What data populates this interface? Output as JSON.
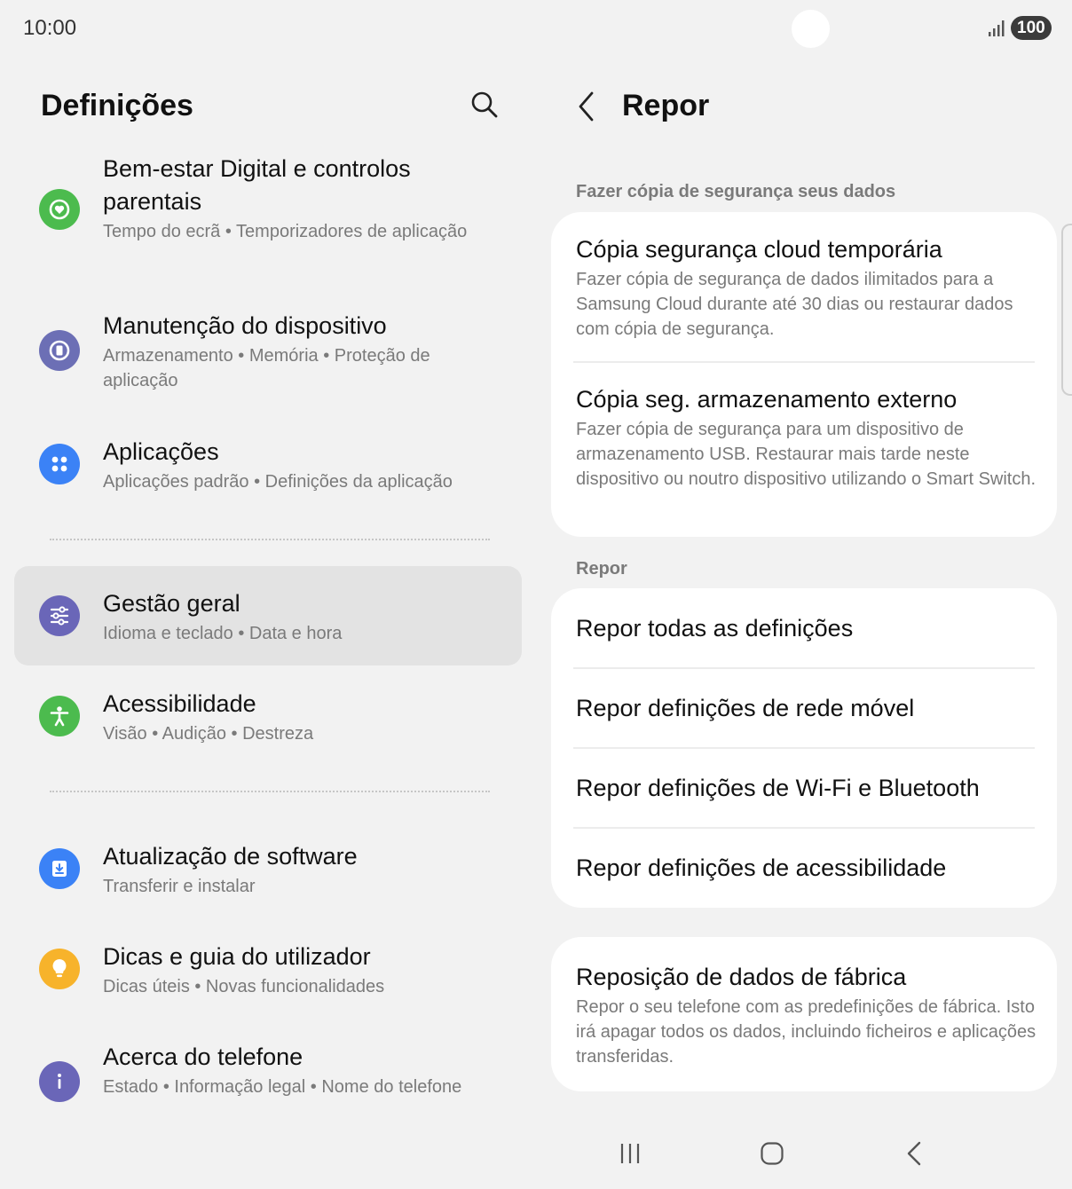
{
  "status_bar": {
    "time": "10:00",
    "battery": "100",
    "signal_icon": "signal-bars-icon"
  },
  "left_pane": {
    "title": "Definições",
    "search_icon": "search-icon",
    "items": [
      {
        "title": "Bem-estar Digital e controlos parentais",
        "subtitle": "Tempo do ecrã  •  Temporizadores de aplicação",
        "icon": "digital-wellbeing-icon",
        "color": "#4cbb4e",
        "selected": false
      },
      {
        "title": "Manutenção do dispositivo",
        "subtitle": "Armazenamento  •  Memória  •  Proteção de aplicação",
        "icon": "device-care-icon",
        "color": "#6c6fb5",
        "selected": false
      },
      {
        "title": "Aplicações",
        "subtitle": "Aplicações padrão  •  Definições da aplicação",
        "icon": "apps-icon",
        "color": "#3b82f6",
        "selected": false
      },
      {
        "title": "Gestão geral",
        "subtitle": "Idioma e teclado  •  Data e hora",
        "icon": "sliders-icon",
        "color": "#6a66b8",
        "selected": true
      },
      {
        "title": "Acessibilidade",
        "subtitle": "Visão  •  Audição  •  Destreza",
        "icon": "accessibility-icon",
        "color": "#4cbb4e",
        "selected": false
      },
      {
        "title": "Atualização de software",
        "subtitle": "Transferir e instalar",
        "icon": "software-update-icon",
        "color": "#3b82f6",
        "selected": false
      },
      {
        "title": "Dicas e guia do utilizador",
        "subtitle": "Dicas úteis  •  Novas funcionalidades",
        "icon": "lightbulb-icon",
        "color": "#f7b32b",
        "selected": false
      },
      {
        "title": "Acerca do telefone",
        "subtitle": "Estado  •  Informação legal  •  Nome do telefone",
        "icon": "info-icon",
        "color": "#6a66b8",
        "selected": false
      }
    ]
  },
  "right_pane": {
    "title": "Repor",
    "back_icon": "chevron-left-icon",
    "backup_section": {
      "header": "Fazer cópia de segurança seus dados",
      "rows": [
        {
          "title": "Cópia segurança cloud temporária",
          "desc": "Fazer cópia de segurança de dados ilimitados para a Samsung Cloud durante até 30 dias ou restaurar dados com cópia de segurança."
        },
        {
          "title": "Cópia seg. armazenamento externo",
          "desc": "Fazer cópia de segurança para um dispositivo de armazenamento USB. Restaurar mais tarde neste dispositivo ou noutro dispositivo utilizando o Smart Switch."
        }
      ]
    },
    "reset_section": {
      "header": "Repor",
      "rows": [
        {
          "title": "Repor todas as definições"
        },
        {
          "title": "Repor definições de rede móvel"
        },
        {
          "title": "Repor definições de Wi-Fi e Bluetooth"
        },
        {
          "title": "Repor definições de acessibilidade"
        }
      ]
    },
    "factory_reset": {
      "title": "Reposição de dados de fábrica",
      "desc": "Repor o seu telefone com as predefinições de fábrica. Isto irá apagar todos os dados, incluindo ficheiros e aplicações transferidas."
    }
  },
  "nav_bar": {
    "recents_icon": "recents-icon",
    "home_icon": "home-icon",
    "back_icon": "back-icon"
  }
}
